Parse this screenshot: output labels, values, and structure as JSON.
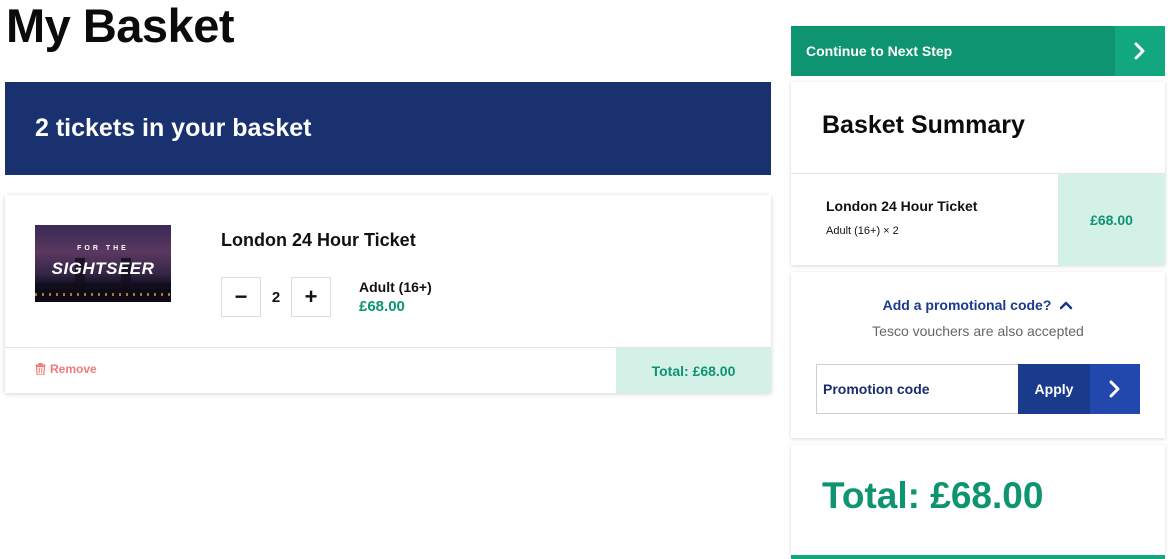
{
  "page": {
    "title": "My Basket"
  },
  "basket": {
    "count_label": "2 tickets in your basket"
  },
  "ticket": {
    "image_subtitle": "FOR THE",
    "image_title": "SIGHTSEER",
    "name": "London 24 Hour Ticket",
    "decrement_symbol": "−",
    "quantity": "2",
    "increment_symbol": "+",
    "fare_type": "Adult (16+)",
    "fare_price": "£68.00",
    "remove_label": "Remove",
    "total_label": "Total: £68.00"
  },
  "actions": {
    "continue_label": "Continue to Next Step"
  },
  "summary": {
    "title": "Basket Summary",
    "item_name": "London 24 Hour Ticket",
    "item_qty": "Adult (16+) × 2",
    "item_price": "£68.00"
  },
  "promo": {
    "toggle_label": "Add a promotional code?",
    "note": "Tesco vouchers are also accepted",
    "placeholder": "Promotion code",
    "apply_label": "Apply"
  },
  "grand_total": "Total: £68.00",
  "icons": {
    "continue": "chevron-right-icon",
    "apply": "chevron-right-icon",
    "promo_toggle": "chevron-up-icon",
    "remove": "trash-icon"
  },
  "colors": {
    "navy": "#1a3170",
    "green": "#0e9470",
    "mint": "#d3f1e7",
    "remove_red": "#f07a7a",
    "promo_blue": "#1a3a8c"
  }
}
